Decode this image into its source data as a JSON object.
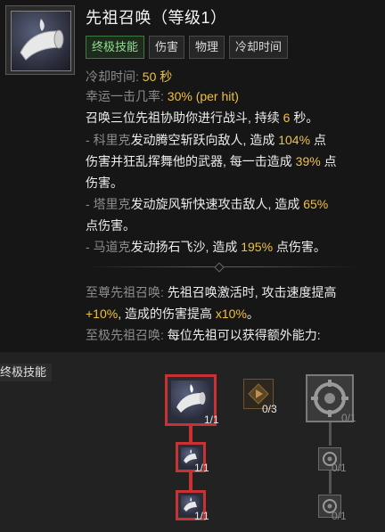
{
  "skill": {
    "title": "先祖召唤（等级1）",
    "tags": [
      "终极技能",
      "伤害",
      "物理",
      "冷却时间"
    ],
    "cooldown_label": "冷却时间:",
    "cooldown_value": "50 秒",
    "lucky_label": "幸运一击几率:",
    "lucky_value": "30% (per hit)",
    "desc": {
      "l1a": "召唤三位先祖协助你进行战斗, 持续",
      "l1b": "6",
      "l1c": "秒。",
      "l2a": "- ",
      "l2b": "科里克",
      "l2c": "发动腾空斩跃向敌人, 造成",
      "l2d": "104%",
      "l2e": "点",
      "l3a": "伤害并狂乱挥舞他的武器, 每一击造成",
      "l3b": "39%",
      "l3c": "点",
      "l4": "伤害。",
      "l5a": "- ",
      "l5b": "塔里克",
      "l5c": "发动旋风斩快速攻击敌人, 造成",
      "l5d": "65%",
      "l6": "点伤害。",
      "l7a": "- ",
      "l7b": "马道克",
      "l7c": "发动扬石飞沙, 造成",
      "l7d": "195%",
      "l7e": "点伤害。"
    },
    "supreme_label": "至尊先祖召唤:",
    "supreme_text_a": "先祖召唤激活时, 攻击速度提高",
    "supreme_text_b": "+10%",
    "supreme_text_c": ", 造成的伤害提高",
    "supreme_text_d": "x10%",
    "supreme_text_e": "。",
    "ultimate_label": "至极先祖召唤:",
    "ultimate_text": "每位先祖可以获得额外能力:"
  },
  "tree": {
    "section_label": "终极技能",
    "main_count": "1/1",
    "mid_count": "0/3",
    "locked_count": "0/1",
    "sub1_count": "1/1",
    "sub2_count": "1/1",
    "locked_sub1_count": "0/1",
    "locked_sub2_count": "0/1"
  },
  "colors": {
    "highlight": "#f0c040",
    "active_border": "#c83232",
    "ultimate_tag": "#8ee08e"
  }
}
